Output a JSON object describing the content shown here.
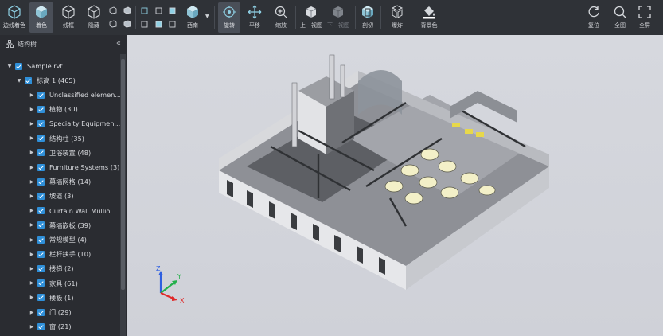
{
  "toolbar": {
    "left_tools": [
      {
        "label": "边线着色",
        "icon": "wireframe-shaded-cube-icon"
      },
      {
        "label": "着色",
        "icon": "shaded-cube-icon",
        "active": true
      },
      {
        "label": "线框",
        "icon": "wireframe-cube-icon"
      },
      {
        "label": "隐藏",
        "icon": "hidden-line-cube-icon"
      }
    ],
    "view_tools": [
      {
        "label": "西南",
        "icon": "southwest-view-cube-icon"
      }
    ],
    "nav_tools": [
      {
        "label": "旋转",
        "icon": "orbit-icon",
        "active": true
      },
      {
        "label": "平移",
        "icon": "pan-icon"
      },
      {
        "label": "缩放",
        "icon": "zoom-icon"
      }
    ],
    "history_tools": [
      {
        "label": "上一视图",
        "icon": "previous-view-icon"
      },
      {
        "label": "下一视图",
        "icon": "next-view-icon",
        "disabled": true
      }
    ],
    "section_tools": [
      {
        "label": "剖切",
        "icon": "section-box-icon"
      }
    ],
    "explode_tools": [
      {
        "label": "爆炸",
        "icon": "explode-icon"
      }
    ],
    "bg_tools": [
      {
        "label": "背景色",
        "icon": "paint-bucket-icon"
      }
    ],
    "right_tools": [
      {
        "label": "复位",
        "icon": "reset-icon"
      },
      {
        "label": "全图",
        "icon": "zoom-extents-icon"
      },
      {
        "label": "全屏",
        "icon": "fullscreen-icon"
      }
    ]
  },
  "sidebar": {
    "title": "结构树",
    "root": "Sample.rvt",
    "level": "标高 1 (465)",
    "items": [
      "Unclassified elemen...",
      "植物 (30)",
      "Specialty Equipmen...",
      "结构柱 (35)",
      "卫浴装置 (48)",
      "Furniture Systems (3)",
      "幕墙网格 (14)",
      "坡道 (3)",
      "Curtain Wall Mullio...",
      "幕墙嵌板 (39)",
      "常规模型 (4)",
      "栏杆扶手 (10)",
      "楼梯 (2)",
      "家具 (61)",
      "楼板 (1)",
      "门 (29)",
      "窗 (21)"
    ]
  },
  "axes": {
    "x": "X",
    "y": "Y",
    "z": "Z",
    "x_color": "#e02a2a",
    "y_color": "#23b04a",
    "z_color": "#2f5fe0"
  },
  "colors": {
    "toolbar_bg": "#2f3237",
    "sidebar_bg": "#2a2c31",
    "accent": "#2f8fd8",
    "viewport_bg": "#d3d5db"
  }
}
